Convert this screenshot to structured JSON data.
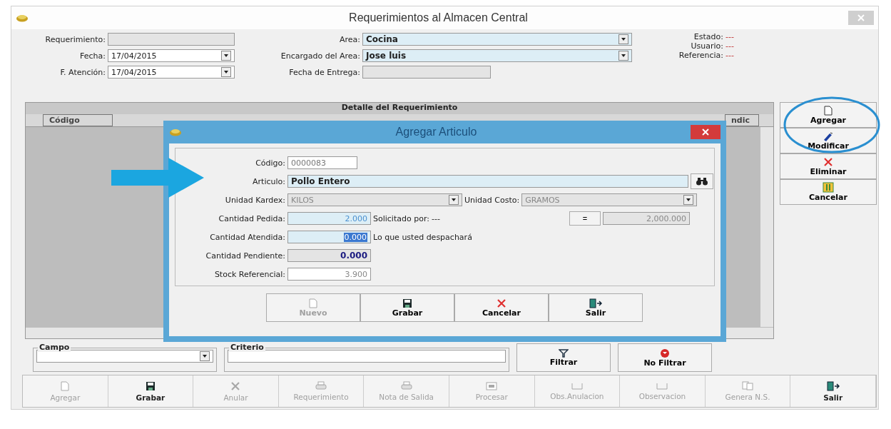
{
  "window": {
    "title": "Requerimientos al Almacen Central"
  },
  "header": {
    "left": [
      {
        "label": "Requerimiento:",
        "kind": "text"
      },
      {
        "label": "Fecha:",
        "value": "17/04/2015",
        "kind": "combo"
      },
      {
        "label": "F. Atención:",
        "value": "17/04/2015",
        "kind": "combo"
      }
    ],
    "middle": [
      {
        "label": "Area:",
        "value": "Cocina",
        "kind": "combo"
      },
      {
        "label": "Encargado del Area:",
        "value": "Jose luis",
        "kind": "combo"
      },
      {
        "label": "Fecha de Entrega:",
        "kind": "text"
      }
    ],
    "right": [
      {
        "label": "Estado:",
        "value": "---"
      },
      {
        "label": "Usuario:",
        "value": "---"
      },
      {
        "label": "Referencia:",
        "value": "---"
      }
    ]
  },
  "grid": {
    "title": "Detalle del Requerimiento",
    "columns": [
      "Código",
      "ndic"
    ]
  },
  "side_buttons": [
    {
      "label": "Agregar",
      "kind": "page"
    },
    {
      "label": "Modificar",
      "kind": "edit"
    },
    {
      "label": "Eliminar",
      "kind": "cross"
    },
    {
      "label": "Cancelar",
      "kind": "cancel"
    }
  ],
  "dialog": {
    "title": "Agregar Articulo",
    "codigo": {
      "label": "Código:",
      "value": "0000083"
    },
    "articulo": {
      "label": "Articulo:",
      "value": "Pollo Entero"
    },
    "unidad_kardex": {
      "label": "Unidad Kardex:",
      "value": "KILOS"
    },
    "unidad_costo": {
      "label": "Unidad Costo:",
      "value": "GRAMOS"
    },
    "cantidad_pedida": {
      "label": "Cantidad Pedida:",
      "value": "2.000"
    },
    "solicitado": {
      "label": "Solicitado por:",
      "value": "---"
    },
    "equals_button": "=",
    "conversion": "2,000.000",
    "cantidad_atendida": {
      "label": "Cantidad Atendida:",
      "value": "0.000",
      "selected": true
    },
    "hint": "Lo que usted despachará",
    "cantidad_pendiente": {
      "label": "Cantidad Pendiente:",
      "value": "0.000"
    },
    "stock": {
      "label": "Stock Referencial:",
      "value": "3.900"
    },
    "buttons": [
      {
        "label": "Nuevo",
        "kind": "page",
        "disabled": true
      },
      {
        "label": "Grabar",
        "kind": "save",
        "disabled": false
      },
      {
        "label": "Cancelar",
        "kind": "cross",
        "disabled": false
      },
      {
        "label": "Salir",
        "kind": "exit",
        "disabled": false
      }
    ]
  },
  "filter": {
    "campo": {
      "label": "Campo"
    },
    "criterio": {
      "label": "Criterio"
    },
    "buttons": [
      {
        "label": "Filtrar",
        "kind": "funnel"
      },
      {
        "label": "No Filtrar",
        "kind": "nofilter"
      }
    ]
  },
  "toolbar": [
    {
      "label": "Agregar",
      "kind": "page",
      "disabled": true
    },
    {
      "label": "Grabar",
      "kind": "save",
      "disabled": false
    },
    {
      "label": "Anular",
      "kind": "cross",
      "disabled": true
    },
    {
      "label": "Requerimiento",
      "kind": "printer",
      "disabled": true
    },
    {
      "label": "Nota de Salida",
      "kind": "printer",
      "disabled": true
    },
    {
      "label": "Procesar",
      "kind": "process",
      "disabled": true
    },
    {
      "label": "Obs.Anulacion",
      "kind": "tray",
      "disabled": true
    },
    {
      "label": "Observacion",
      "kind": "tray",
      "disabled": true
    },
    {
      "label": "Genera N.S.",
      "kind": "copy",
      "disabled": true
    },
    {
      "label": "Salir",
      "kind": "exit",
      "disabled": false
    }
  ]
}
